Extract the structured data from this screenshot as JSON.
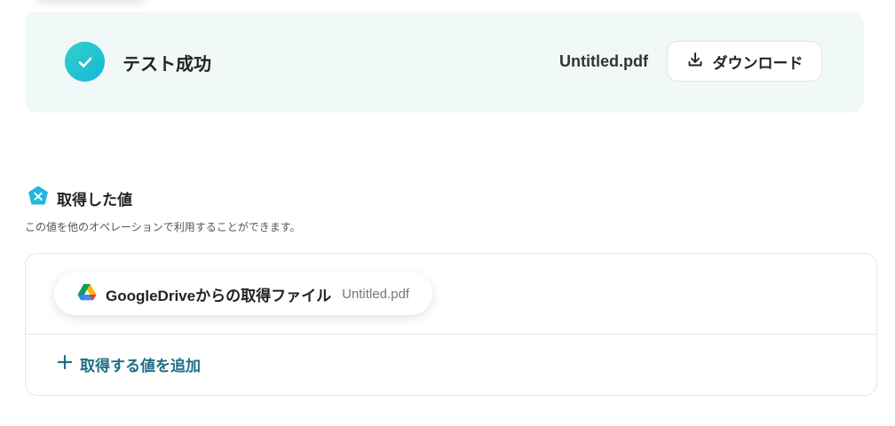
{
  "result": {
    "status_text": "テスト成功",
    "filename": "Untitled.pdf",
    "download_label": "ダウンロード"
  },
  "section": {
    "title": "取得した値",
    "description": "この値を他のオペレーションで利用することができます。"
  },
  "values": [
    {
      "icon": "google-drive-icon",
      "name": "GoogleDriveからの取得ファイル",
      "value": "Untitled.pdf"
    }
  ],
  "add_value_label": "取得する値を追加",
  "colors": {
    "panel_bg": "#f1f9f8",
    "check_gradient_start": "#34d0c6",
    "check_gradient_end": "#12b9d8",
    "accent_text": "#1e6e87"
  }
}
